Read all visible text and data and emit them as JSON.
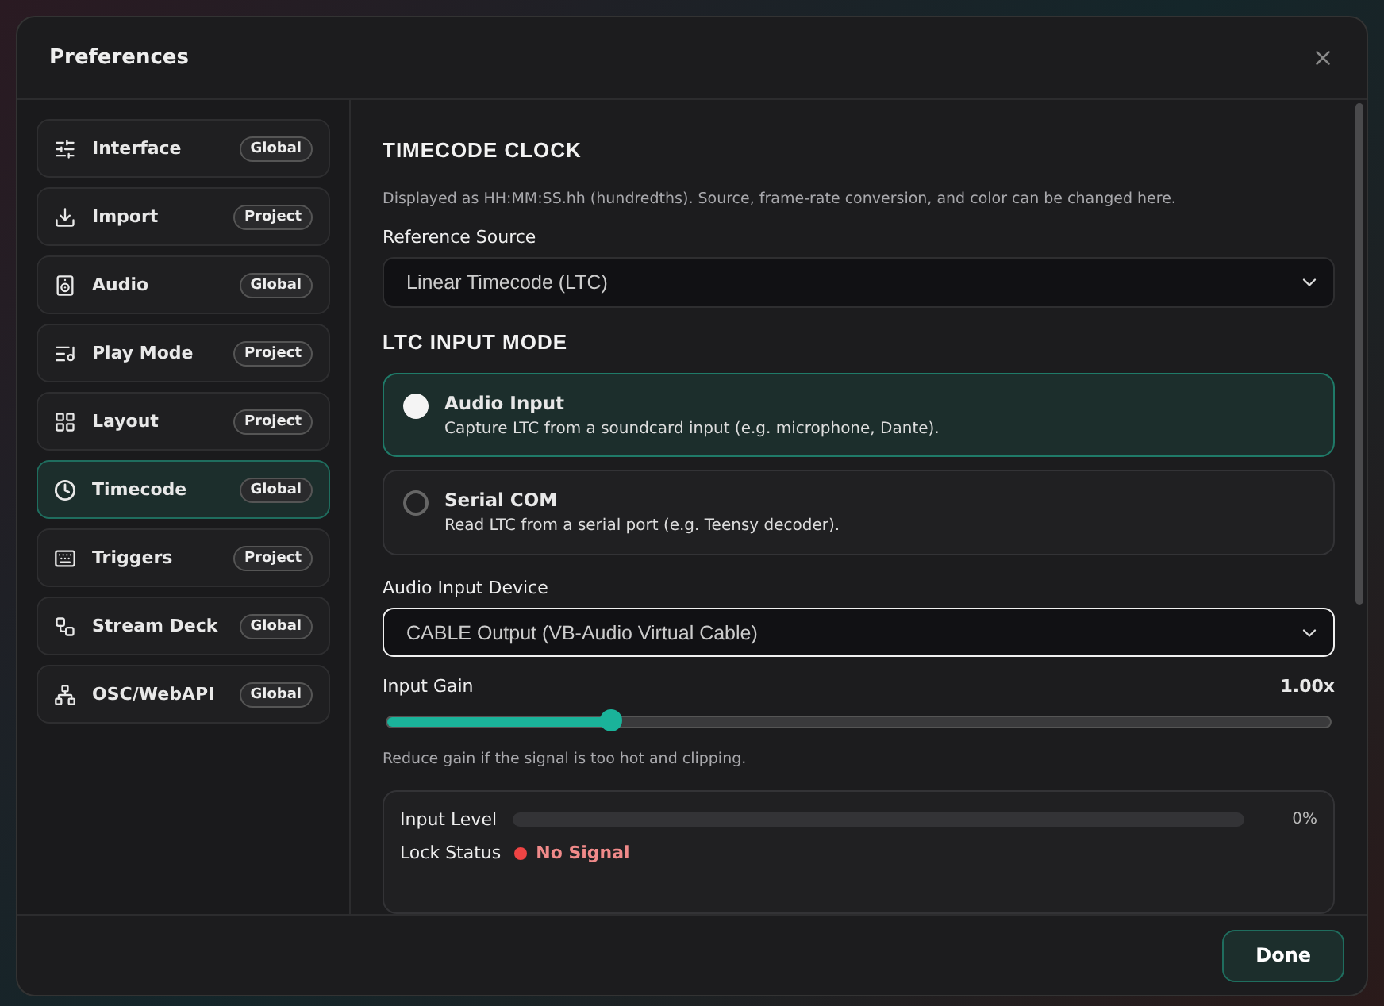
{
  "window": {
    "title": "Preferences"
  },
  "sidebar": {
    "items": [
      {
        "label": "Interface",
        "badge": "Global",
        "selected": false
      },
      {
        "label": "Import",
        "badge": "Project",
        "selected": false
      },
      {
        "label": "Audio",
        "badge": "Global",
        "selected": false
      },
      {
        "label": "Play Mode",
        "badge": "Project",
        "selected": false
      },
      {
        "label": "Layout",
        "badge": "Project",
        "selected": false
      },
      {
        "label": "Timecode",
        "badge": "Global",
        "selected": true
      },
      {
        "label": "Triggers",
        "badge": "Project",
        "selected": false
      },
      {
        "label": "Stream Deck",
        "badge": "Global",
        "selected": false
      },
      {
        "label": "OSC/WebAPI",
        "badge": "Global",
        "selected": false
      }
    ]
  },
  "content": {
    "section_title": "TIMECODE CLOCK",
    "description": "Displayed as HH:MM:SS.hh (hundredths). Source, frame-rate conversion, and color can be changed here.",
    "reference_source": {
      "label": "Reference Source",
      "value": "Linear Timecode (LTC)"
    },
    "mode_title": "LTC INPUT MODE",
    "modes": [
      {
        "title": "Audio Input",
        "description": "Capture LTC from a soundcard input (e.g. microphone, Dante).",
        "selected": true
      },
      {
        "title": "Serial COM",
        "description": "Read LTC from a serial port (e.g. Teensy decoder).",
        "selected": false
      }
    ],
    "device": {
      "label": "Audio Input Device",
      "value": "CABLE Output (VB-Audio Virtual Cable)"
    },
    "gain": {
      "label": "Input Gain",
      "reading": "1.00x",
      "level": 0.237,
      "hint": "Reduce gain if the signal is too hot and clipping."
    },
    "status": {
      "level_label": "Input Level",
      "level_reading": "0%",
      "lock_label": "Lock Status",
      "lock": {
        "value": "No Signal",
        "color": "#ef4444"
      }
    }
  },
  "footer": {
    "button": "Done"
  }
}
